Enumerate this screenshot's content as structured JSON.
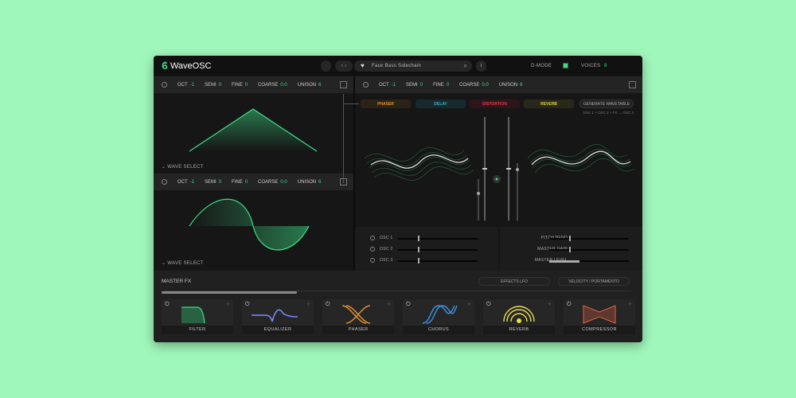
{
  "app": {
    "name": "WaveOSC",
    "preset": "Faux Bass Sidechain",
    "d_mode_label": "D-MODE",
    "voices_label": "VOICES",
    "voices": "8"
  },
  "osc1": {
    "oct_label": "OCT",
    "oct": "-1",
    "semi_label": "SEMI",
    "semi": "0",
    "fine_label": "FINE",
    "fine": "0",
    "coarse_label": "COARSE",
    "coarse": "0.0",
    "unison_label": "UNISON",
    "unison": "6",
    "wave_select": "WAVE SELECT"
  },
  "osc2": {
    "oct_label": "OCT",
    "oct": "-1",
    "semi_label": "SEMI",
    "semi": "0",
    "fine_label": "FINE",
    "fine": "0",
    "coarse_label": "COARSE",
    "coarse": "0.0",
    "unison_label": "UNISON",
    "unison": "6",
    "wave_select": "WAVE SELECT"
  },
  "osc3": {
    "oct_label": "OCT",
    "oct": "-1",
    "semi_label": "SEMI",
    "semi": "0",
    "fine_label": "FINE",
    "fine": "0",
    "coarse_label": "COARSE",
    "coarse": "0.0",
    "unison_label": "UNISON",
    "unison": "6"
  },
  "fx_chain": [
    {
      "label": "PHASER",
      "color": "#e0902a"
    },
    {
      "label": "DELAY",
      "color": "#3ab0c0"
    },
    {
      "label": "DISTORTION",
      "color": "#e03a4a"
    },
    {
      "label": "REVERB",
      "color": "#d8d040"
    }
  ],
  "generate_label": "GENERATE WAVETABLE",
  "routing": "OSC 1 + OSC 2 + FX → OSC 3",
  "mixer": {
    "osc": [
      {
        "label": "OSC 1",
        "value": 0.25
      },
      {
        "label": "OSC 2",
        "value": 0.25
      },
      {
        "label": "OSC 3",
        "value": 0.25
      }
    ],
    "master": [
      {
        "label": "PITCH BEND",
        "value": 0.25
      },
      {
        "label": "MASTER GAIN",
        "value": 0.25
      },
      {
        "label": "MASTER LEVEL",
        "value": 0.38
      }
    ]
  },
  "master_fx": {
    "title": "MASTER FX",
    "lfo_label": "EFFECTS LFO",
    "velocity_label": "VELOCITY / PORTAMENTO",
    "scroll": 0.3,
    "cards": [
      {
        "label": "FILTER"
      },
      {
        "label": "EQUALIZER"
      },
      {
        "label": "PHASER"
      },
      {
        "label": "CHORUS"
      },
      {
        "label": "REVERB"
      },
      {
        "label": "COMPRESSOR"
      }
    ]
  }
}
